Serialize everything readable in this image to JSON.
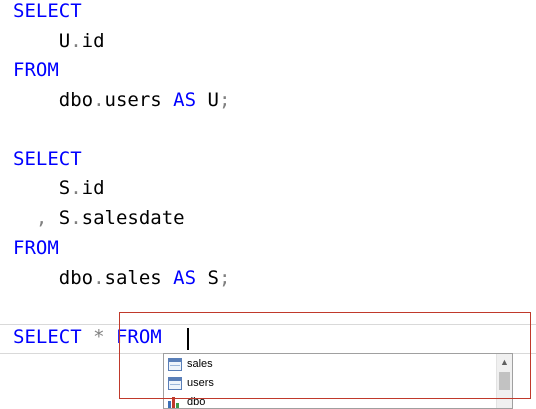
{
  "editor": {
    "lines": [
      {
        "kw": "SELECT"
      },
      {
        "pre": "    U",
        "dot": ".",
        "post": "id"
      },
      {
        "kw": "FROM"
      },
      {
        "pre": "    dbo",
        "dot": ".",
        "post": "users ",
        "kw2": "AS",
        "post2": " U",
        "end": ";"
      },
      {
        "kw": "SELECT"
      },
      {
        "pre": "    S",
        "dot": ".",
        "post": "id"
      },
      {
        "comma": "  ,",
        "pre": " S",
        "dot": ".",
        "post": "salesdate"
      },
      {
        "kw": "FROM"
      },
      {
        "pre": "    dbo",
        "dot": ".",
        "post": "sales ",
        "kw2": "AS",
        "post2": " S",
        "end": ";"
      },
      {
        "kw": "SELECT",
        "star": " * ",
        "kw2": "FROM",
        "post2": " "
      }
    ]
  },
  "autocomplete": {
    "items": [
      {
        "label": "sales",
        "icon": "table-icon"
      },
      {
        "label": "users",
        "icon": "table-icon"
      },
      {
        "label": "dbo",
        "icon": "schema-icon"
      }
    ],
    "scroll_up_glyph": "▲"
  },
  "colors": {
    "keyword": "#0000ff",
    "operator": "#808080",
    "highlight": "#c0392b"
  }
}
